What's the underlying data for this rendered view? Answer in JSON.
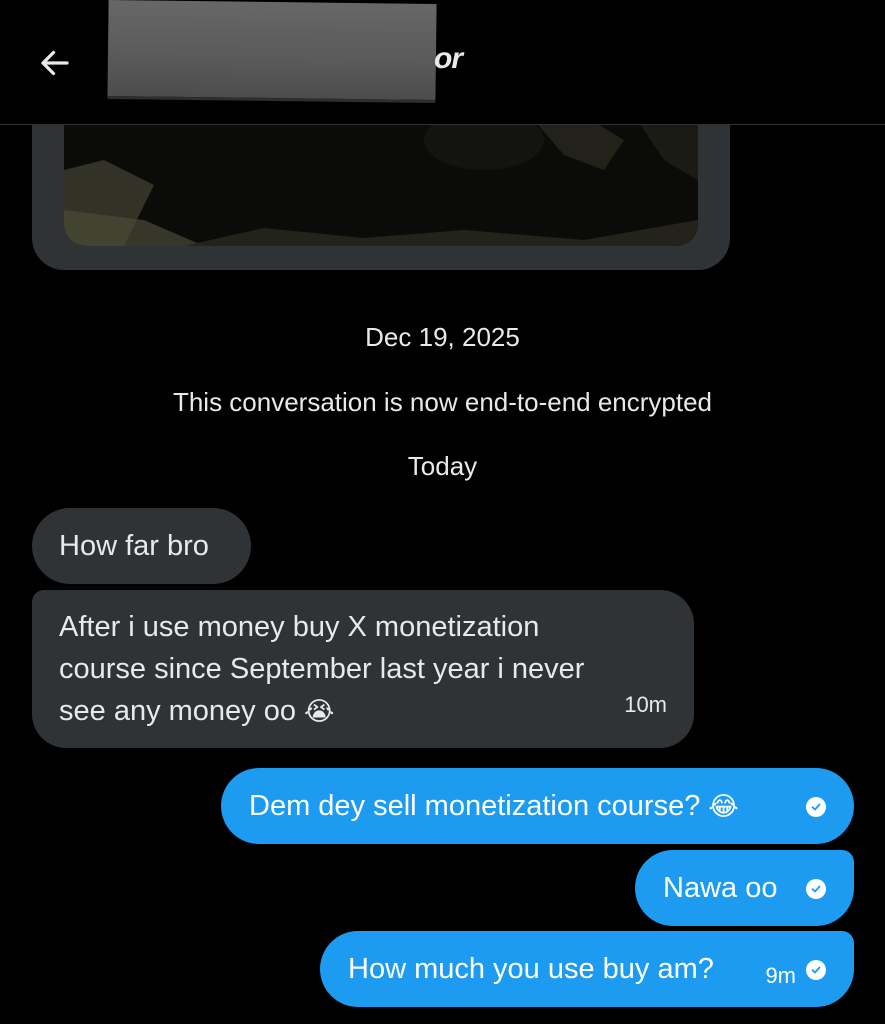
{
  "header": {
    "name_visible_suffix": "or",
    "back_icon": "arrow-left-icon"
  },
  "conversation": {
    "date_label": "Dec 19, 2025",
    "encryption_notice": "This conversation is now end-to-end encrypted",
    "today_label": "Today"
  },
  "messages": [
    {
      "direction": "incoming",
      "text": "How far bro"
    },
    {
      "direction": "incoming",
      "lines": [
        "After i use money buy X monetization",
        "course since September last year i never",
        "see any money oo"
      ],
      "emoji": "😭",
      "time": "10m"
    },
    {
      "direction": "outgoing",
      "text": "Dem dey sell monetization course?",
      "emoji": "😂",
      "status_icon": "sent-check-icon"
    },
    {
      "direction": "outgoing",
      "text": "Nawa oo",
      "status_icon": "sent-check-icon"
    },
    {
      "direction": "outgoing",
      "text": "How much you use buy am?",
      "time": "9m",
      "status_icon": "sent-check-icon"
    }
  ],
  "colors": {
    "background": "#000000",
    "incoming_bubble": "#2f3336",
    "outgoing_bubble": "#1d9bf0",
    "text": "#e7e9ea"
  }
}
